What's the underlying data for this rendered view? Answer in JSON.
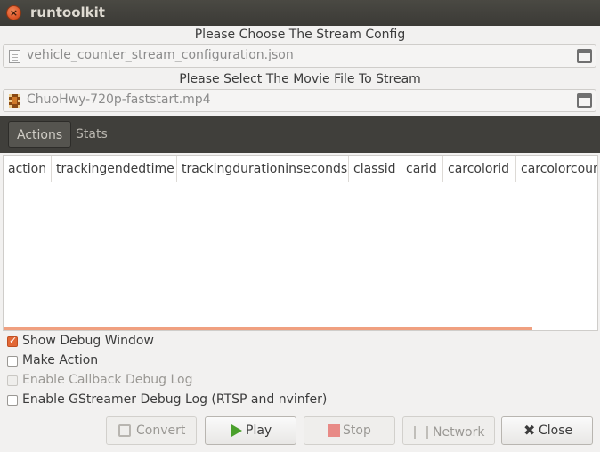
{
  "window": {
    "title": "runtoolkit"
  },
  "config": {
    "heading": "Please Choose The Stream Config",
    "file": "vehicle_counter_stream_configuration.json"
  },
  "movie": {
    "heading": "Please Select The Movie File To Stream",
    "file": "ChuoHwy-720p-faststart.mp4"
  },
  "tabs": [
    {
      "label": "Actions",
      "active": true
    },
    {
      "label": "Stats",
      "active": false
    }
  ],
  "table": {
    "columns": [
      "action",
      "trackingendedtime",
      "trackingdurationinseconds",
      "classid",
      "carid",
      "carcolorid",
      "carcolorcount"
    ]
  },
  "options": [
    {
      "label": "Show Debug Window",
      "checked": true,
      "enabled": true
    },
    {
      "label": "Make Action",
      "checked": false,
      "enabled": true
    },
    {
      "label": "Enable Callback Debug Log",
      "checked": false,
      "enabled": false
    },
    {
      "label": "Enable GStreamer Debug Log (RTSP and nvinfer)",
      "checked": false,
      "enabled": true
    }
  ],
  "buttons": {
    "convert": "Convert",
    "play": "Play",
    "stop": "Stop",
    "network": "Network",
    "close": "Close"
  },
  "colors": {
    "accent": "#e26836",
    "titlebar": "#3b3a36",
    "play": "#4aa02c",
    "stop": "#e88a86"
  },
  "icons": {
    "close_window": "close-window-icon",
    "json_file": "document-icon",
    "movie_file": "film-icon",
    "eject": "eject-icon",
    "play": "play-icon",
    "stop": "stop-icon",
    "convert": "convert-icon",
    "network": "network-icon",
    "close": "close-icon"
  }
}
